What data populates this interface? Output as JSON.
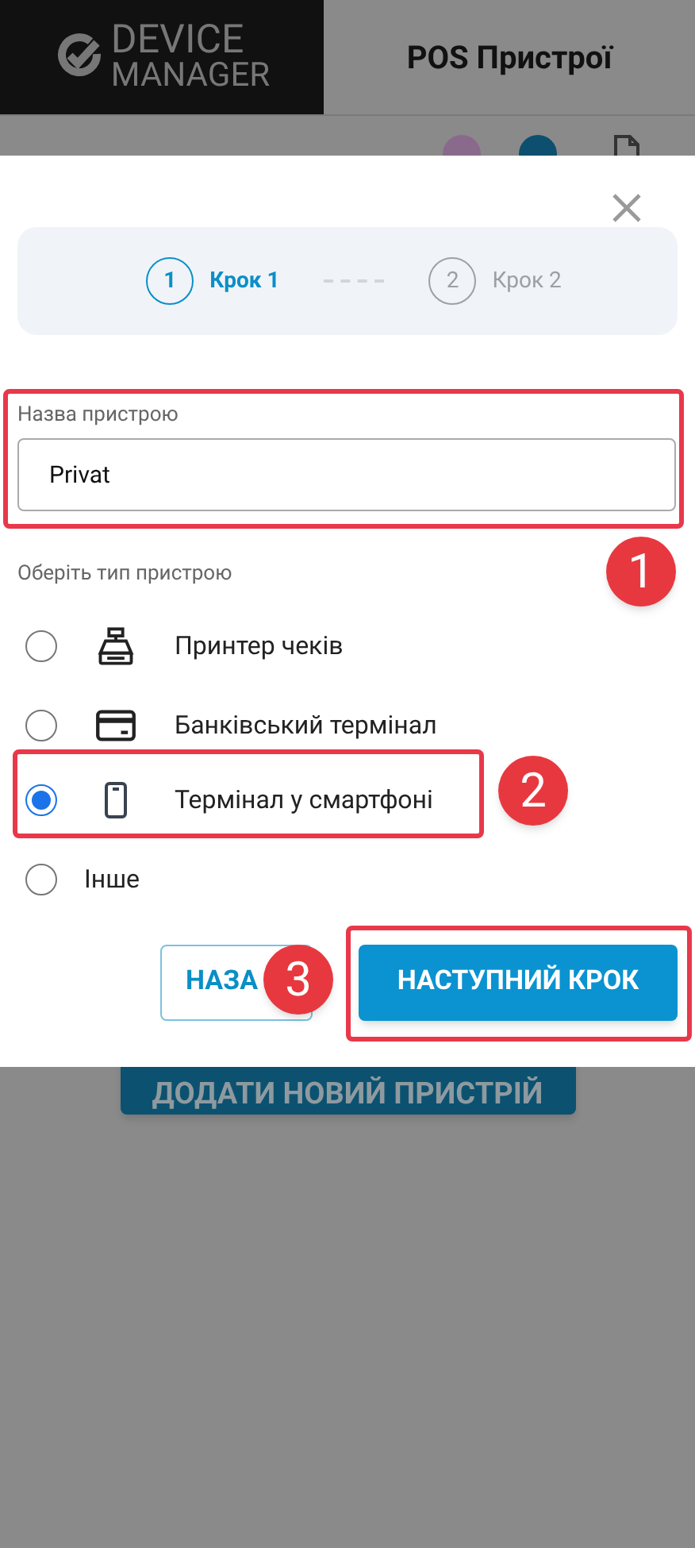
{
  "header": {
    "logo_top": "DEVICE",
    "logo_bottom": "MANAGER",
    "title": "POS Пристрої"
  },
  "background_button": {
    "label": "ДОДАТИ НОВИЙ ПРИСТРІЙ"
  },
  "dialog": {
    "steps": [
      {
        "number": "1",
        "label": "Крок 1",
        "selected": true
      },
      {
        "number": "2",
        "label": "Крок 2",
        "selected": false
      }
    ],
    "name_field": {
      "label": "Назва пристрою",
      "value": "Privat",
      "highlighted": true
    },
    "type_label": "Оберіть тип пристрою",
    "options": [
      {
        "label": "Принтер чеків",
        "kind": "icon",
        "selected": false,
        "highlighted": false
      },
      {
        "label": "Банківський термінал",
        "kind": "icon",
        "selected": false,
        "highlighted": false
      },
      {
        "label": "Термінал у смартфоні",
        "kind": "icon",
        "selected": true,
        "highlighted": true
      },
      {
        "label": "Інше",
        "kind": "plain",
        "selected": false,
        "highlighted": false
      }
    ],
    "back_button": {
      "label": "НАЗА"
    },
    "next_button": {
      "label": "НАСТУПНИЙ КРОК",
      "highlighted": true
    }
  },
  "annotations": [
    {
      "label": "1"
    },
    {
      "label": "2"
    },
    {
      "label": "3"
    }
  ]
}
